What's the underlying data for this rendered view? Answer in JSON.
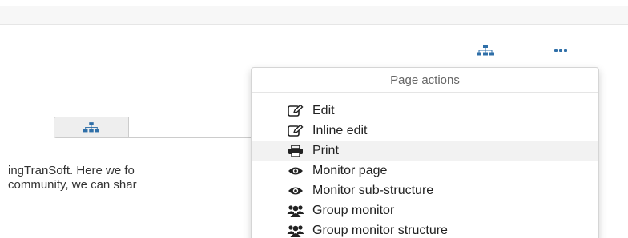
{
  "search": {
    "value": "",
    "placeholder": ""
  },
  "body_text": {
    "line1": "ingTranSoft. Here we fo",
    "line2": "community, we can shar"
  },
  "page_actions": {
    "title": "Page actions",
    "items": [
      {
        "label": "Edit",
        "icon": "edit-icon"
      },
      {
        "label": "Inline edit",
        "icon": "edit-icon"
      },
      {
        "label": "Print",
        "icon": "print-icon"
      },
      {
        "label": "Monitor page",
        "icon": "eye-icon"
      },
      {
        "label": "Monitor sub-structure",
        "icon": "eye-icon"
      },
      {
        "label": "Group monitor",
        "icon": "users-icon"
      },
      {
        "label": "Group monitor structure",
        "icon": "users-icon"
      }
    ],
    "highlighted_item": "Print"
  },
  "colors": {
    "accent": "#2f6fa8",
    "icon_dark": "#222222"
  }
}
